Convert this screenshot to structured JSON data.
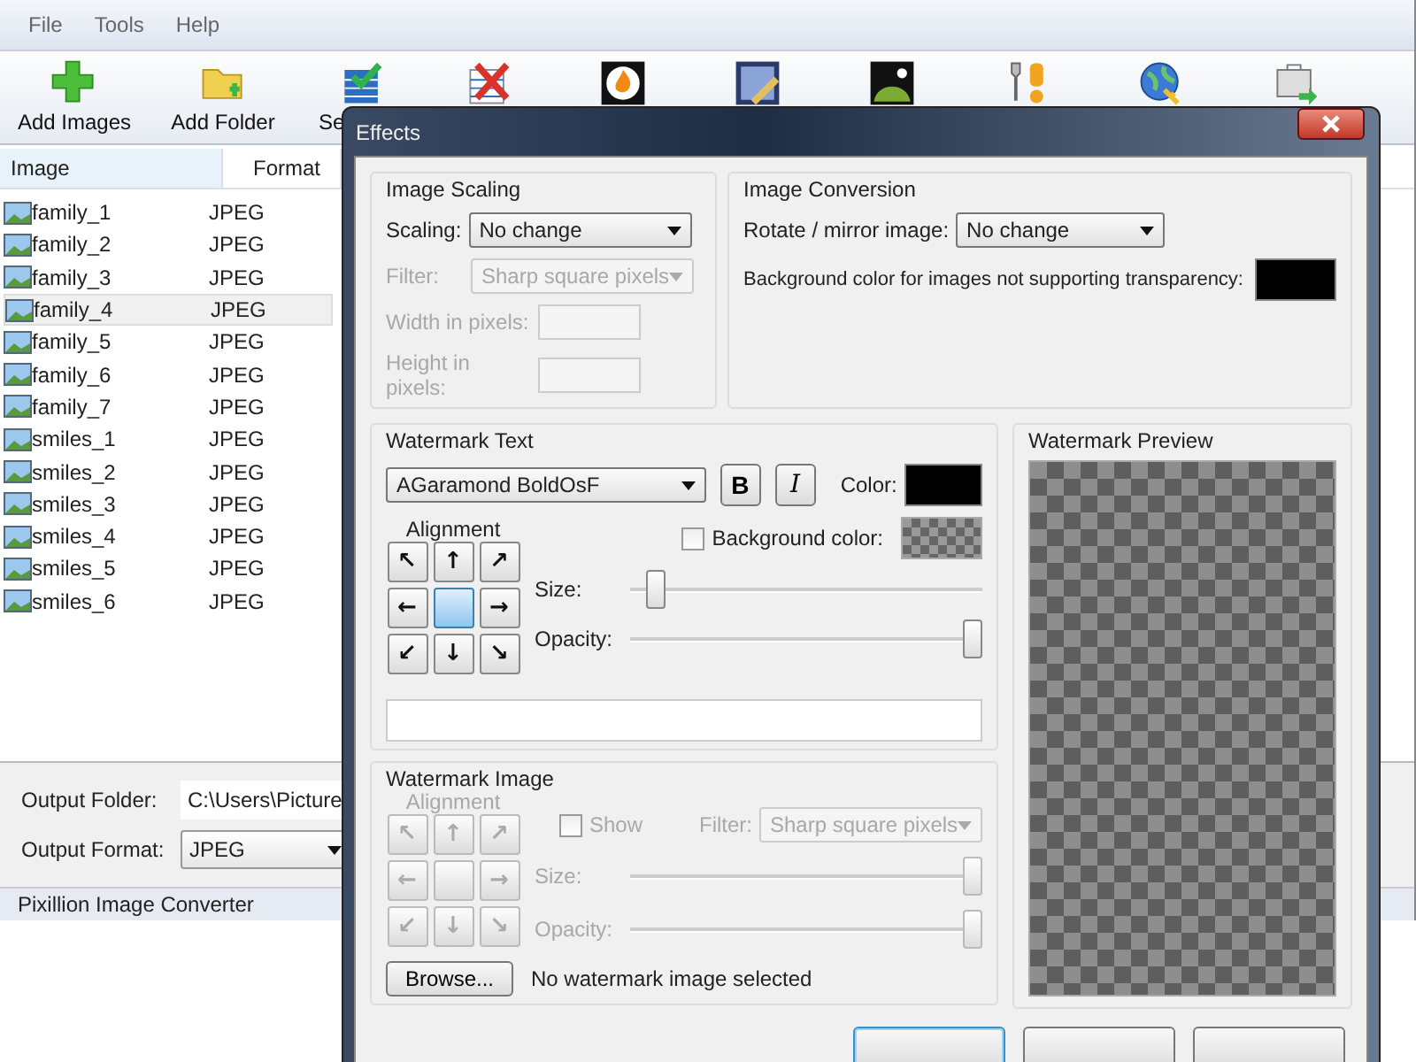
{
  "window": {
    "menu": [
      "File",
      "Tools",
      "Help"
    ],
    "status_bar": "Pixillion Image Converter"
  },
  "toolbar": [
    {
      "label": "Add Images",
      "kind": "add"
    },
    {
      "label": "Add Folder",
      "kind": "folder"
    },
    {
      "label": "Se",
      "kind": "select"
    },
    {
      "kind": "remove"
    },
    {
      "kind": "flame"
    },
    {
      "kind": "edit"
    },
    {
      "kind": "photo"
    },
    {
      "kind": "tools"
    },
    {
      "kind": "globe"
    },
    {
      "kind": "export"
    }
  ],
  "table": {
    "columns": [
      "Image",
      "Format"
    ],
    "rows": [
      {
        "name": "family_1",
        "format": "JPEG",
        "selected": false
      },
      {
        "name": "family_2",
        "format": "JPEG",
        "selected": false
      },
      {
        "name": "family_3",
        "format": "JPEG",
        "selected": false
      },
      {
        "name": "family_4",
        "format": "JPEG",
        "selected": true
      },
      {
        "name": "family_5",
        "format": "JPEG",
        "selected": false
      },
      {
        "name": "family_6",
        "format": "JPEG",
        "selected": false
      },
      {
        "name": "family_7",
        "format": "JPEG",
        "selected": false
      },
      {
        "name": "smiles_1",
        "format": "JPEG",
        "selected": false
      },
      {
        "name": "smiles_2",
        "format": "JPEG",
        "selected": false
      },
      {
        "name": "smiles_3",
        "format": "JPEG",
        "selected": false
      },
      {
        "name": "smiles_4",
        "format": "JPEG",
        "selected": false
      },
      {
        "name": "smiles_5",
        "format": "JPEG",
        "selected": false
      },
      {
        "name": "smiles_6",
        "format": "JPEG",
        "selected": false
      }
    ]
  },
  "output": {
    "folder_label": "Output Folder:",
    "folder": "C:\\Users\\Picture",
    "format_label": "Output Format:",
    "format": "JPEG"
  },
  "dialog": {
    "title": "Effects",
    "image_scaling": {
      "title": "Image Scaling",
      "scaling_label": "Scaling:",
      "scaling": "No change",
      "filter_label": "Filter:",
      "filter": "Sharp square pixels",
      "width_label": "Width in pixels:",
      "height_label": "Height in pixels:",
      "disabled": true
    },
    "image_conversion": {
      "title": "Image Conversion",
      "rotate_label": "Rotate / mirror image:",
      "rotate": "No change",
      "background_label": "Background color for images not supporting transparency:",
      "background_swatch": {
        "color": "#000000"
      }
    },
    "watermark_text": {
      "title": "Watermark Text",
      "font": "AGaramond BoldOsF",
      "bold_button": "B",
      "italic_button": "I",
      "color_label": "Color:",
      "color": "#000000",
      "alignment_label": "Alignment",
      "background_label": "Background color:",
      "background_checked": false,
      "size": {
        "label": "Size:",
        "level": 0.05
      },
      "opacity": {
        "label": "Opacity:",
        "level": 1
      },
      "disabled": false,
      "alignment": [
        {
          "arrow": "↖",
          "selected": false
        },
        {
          "arrow": "↑",
          "selected": false
        },
        {
          "arrow": "↗",
          "selected": false
        },
        {
          "arrow": "←",
          "selected": false
        },
        {
          "selected": true
        },
        {
          "arrow": "→",
          "selected": false
        },
        {
          "arrow": "↙",
          "selected": false
        },
        {
          "arrow": "↓",
          "selected": false
        },
        {
          "arrow": "↘",
          "selected": false
        }
      ]
    },
    "watermark_image": {
      "title": "Watermark Image",
      "alignment_label": "Alignment",
      "show_label": "Show",
      "show_checked": false,
      "filter_label": "Filter:",
      "filter": "Sharp square pixels",
      "size": {
        "label": "Size:",
        "level": 1
      },
      "opacity": {
        "label": "Opacity:",
        "level": 1
      },
      "browse_button": "Browse...",
      "status": "No watermark image selected",
      "disabled": true,
      "alignment": [
        {
          "arrow": "↖",
          "selected": false
        },
        {
          "arrow": "↑",
          "selected": false
        },
        {
          "arrow": "↗",
          "selected": false
        },
        {
          "arrow": "←",
          "selected": false
        },
        {
          "selected": false
        },
        {
          "arrow": "→",
          "selected": false
        },
        {
          "arrow": "↙",
          "selected": false
        },
        {
          "arrow": "↓",
          "selected": false
        },
        {
          "arrow": "↘",
          "selected": false
        }
      ]
    },
    "preview": {
      "title": "Watermark Preview"
    },
    "buttons": [
      {
        "kind": "default"
      },
      {
        "kind": "normal"
      },
      {
        "kind": "normal"
      }
    ]
  }
}
